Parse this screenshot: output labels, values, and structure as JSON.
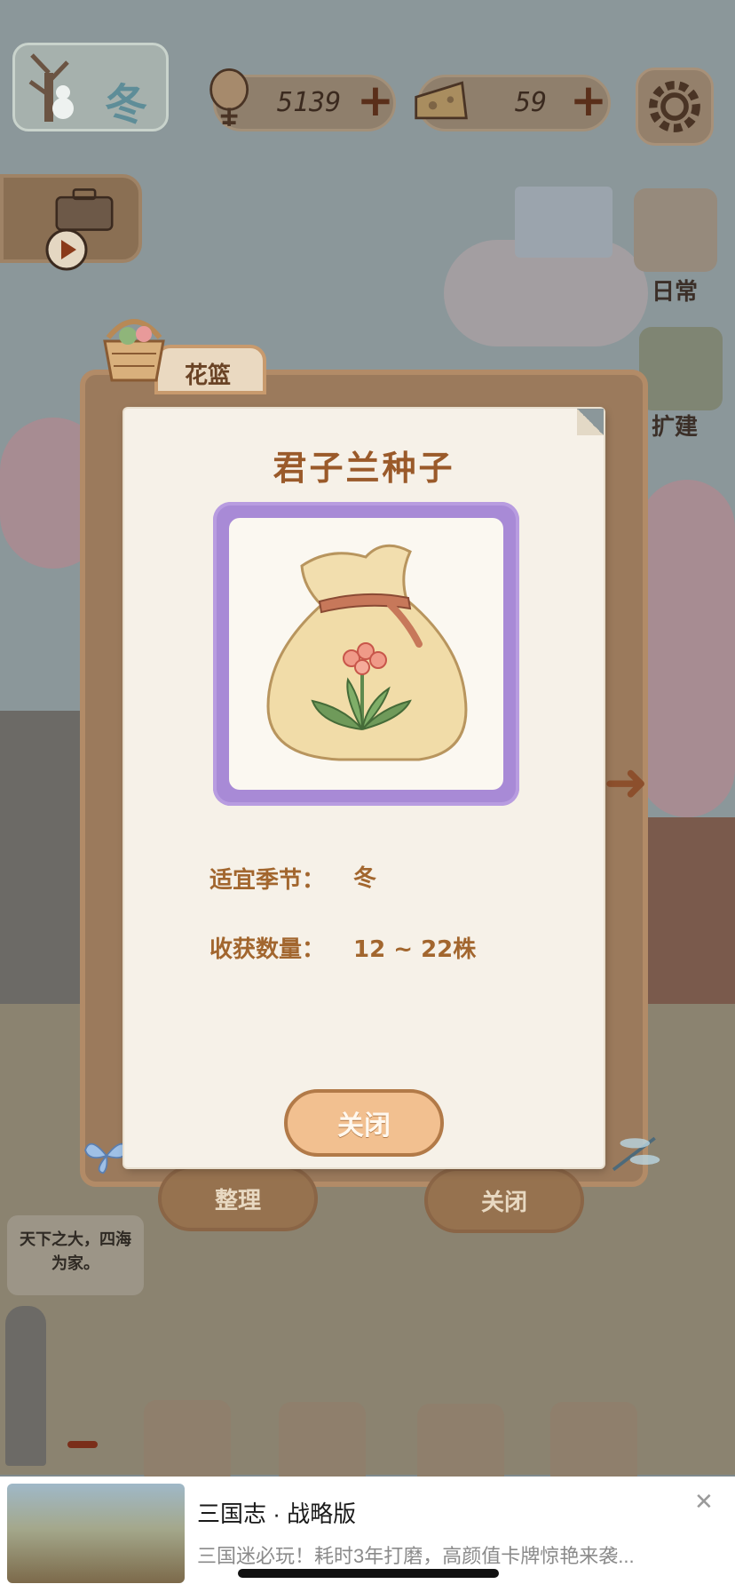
{
  "top_bar": {
    "season": "冬",
    "fish_count": "5139",
    "cheese_count": "59",
    "plus_label": "+"
  },
  "side_buttons": {
    "daily_label": "日常",
    "expand_label": "扩建"
  },
  "basket_window": {
    "tab_label": "花篮",
    "organize_label": "整理",
    "close_label": "关闭",
    "next_arrow": "➜"
  },
  "item_card": {
    "title": "君子兰种子",
    "season_label": "适宜季节：",
    "season_value": "冬",
    "harvest_label": "收获数量：",
    "harvest_value": "12 ~ 22株",
    "close_label": "关闭"
  },
  "npc": {
    "speech": "天下之大，四海为家。"
  },
  "ad": {
    "title": "三国志 · 战略版",
    "description": "三国迷必玩！耗时3年打磨，高颜值卡牌惊艳来袭...",
    "close_symbol": "✕"
  },
  "colors": {
    "window_brown": "#9b7a5c",
    "frame_purple": "#a88ad6",
    "title_brown": "#9a5a2a",
    "button_orange": "#f2c090"
  }
}
